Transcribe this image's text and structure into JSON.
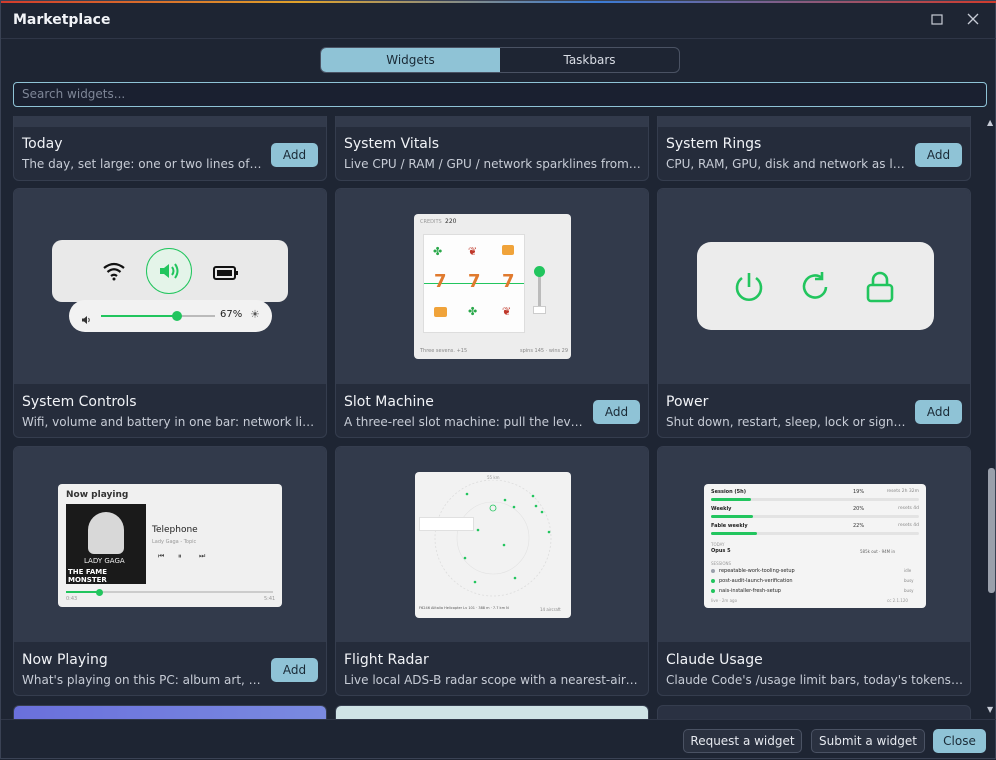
{
  "window": {
    "title": "Marketplace"
  },
  "tabs": [
    "Widgets",
    "Taskbars"
  ],
  "search": {
    "placeholder": "Search widgets..."
  },
  "add_label": "Add",
  "cards": [
    {
      "name": "Today",
      "desc": "The day, set large: one or two lines of week...",
      "add": true
    },
    {
      "name": "System Vitals",
      "desc": "Live CPU / RAM / GPU / network sparklines from the h...",
      "add": false
    },
    {
      "name": "System Rings",
      "desc": "CPU, RAM, GPU, disk and network as live th...",
      "add": true
    },
    {
      "name": "System Controls",
      "desc": "Wifi, volume and battery in one bar: network list with ...",
      "add": false
    },
    {
      "name": "Slot Machine",
      "desc": "A three-reel slot machine: pull the lever, lan...",
      "add": true
    },
    {
      "name": "Power",
      "desc": "Shut down, restart, sleep, lock or sign out, fr...",
      "add": true
    },
    {
      "name": "Now Playing",
      "desc": "What's playing on this PC: album art, track i...",
      "add": true
    },
    {
      "name": "Flight Radar",
      "desc": "Live local ADS-B radar scope with a nearest-aircraft re...",
      "add": false
    },
    {
      "name": "Claude Usage",
      "desc": "Claude Code's /usage limit bars, today's tokens by mo...",
      "add": false
    }
  ],
  "previews": {
    "controls": {
      "volume_pct": "67%",
      "volume_level": 0.67
    },
    "slot": {
      "credits_label": "CREDITS",
      "credits": "220",
      "reels": [
        "7",
        "7",
        "7"
      ],
      "footer_left": "Three sevens. +15",
      "footer_right": "spins 145 · wins 29"
    },
    "nowplaying": {
      "header": "Now playing",
      "track": "Telephone",
      "artist": "Lady Gaga - Topic",
      "art_text_1": "LADY GAGA",
      "art_text_2": "THE FAME MONSTER",
      "elapsed": "0:43",
      "total": "5:41",
      "progress": 0.16
    },
    "radar": {
      "range": "55 km",
      "footer_left": "F6246 Alitalia Helicopter Lv 101 · 388 m · 7.7 km N",
      "footer_right": "14 aircraft"
    },
    "usage": {
      "bars": [
        {
          "label": "Session (5h)",
          "value": "19%",
          "reset": "resets 2h 32m",
          "level": 0.19
        },
        {
          "label": "Weekly",
          "value": "20%",
          "reset": "resets 4d",
          "level": 0.2
        },
        {
          "label": "Fable weekly",
          "value": "22%",
          "reset": "resets 4d",
          "level": 0.22
        }
      ],
      "today_label": "TODAY",
      "model": "Opus 5",
      "model_tokens": "585k out · 94M in",
      "sessions_label": "SESSIONS",
      "sessions": [
        {
          "name": "repeatable-work-tooling-setup",
          "state": "idle"
        },
        {
          "name": "post-audit-launch-verification",
          "state": "busy"
        },
        {
          "name": "nais-installer-fresh-setup",
          "state": "busy"
        }
      ],
      "footer_left": "live · 2m ago",
      "footer_right": "cc 2.1.120"
    }
  },
  "footer": {
    "request": "Request a widget",
    "submit": "Submit a widget",
    "close": "Close"
  },
  "colors": {
    "accent": "#8fc3d6",
    "green": "#22c55e",
    "bg": "#1e2533"
  }
}
